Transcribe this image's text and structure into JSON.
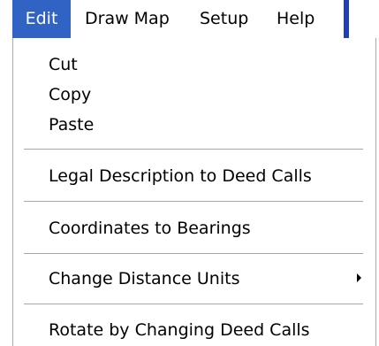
{
  "menubar": {
    "items": [
      {
        "label": "Edit",
        "active": true
      },
      {
        "label": "Draw Map"
      },
      {
        "label": "Setup"
      },
      {
        "label": "Help"
      }
    ]
  },
  "dropdown": {
    "items": [
      {
        "label": "Cut"
      },
      {
        "label": "Copy"
      },
      {
        "label": "Paste"
      },
      {
        "label": "Legal Description to Deed Calls"
      },
      {
        "label": "Coordinates to Bearings"
      },
      {
        "label": "Change Distance Units",
        "has_submenu": true
      },
      {
        "label": "Rotate by Changing Deed Calls"
      }
    ]
  },
  "colors": {
    "highlight": "#3163c5",
    "separator": "#a7a7a7"
  },
  "icons": {
    "submenu": "chevron-right-icon"
  }
}
